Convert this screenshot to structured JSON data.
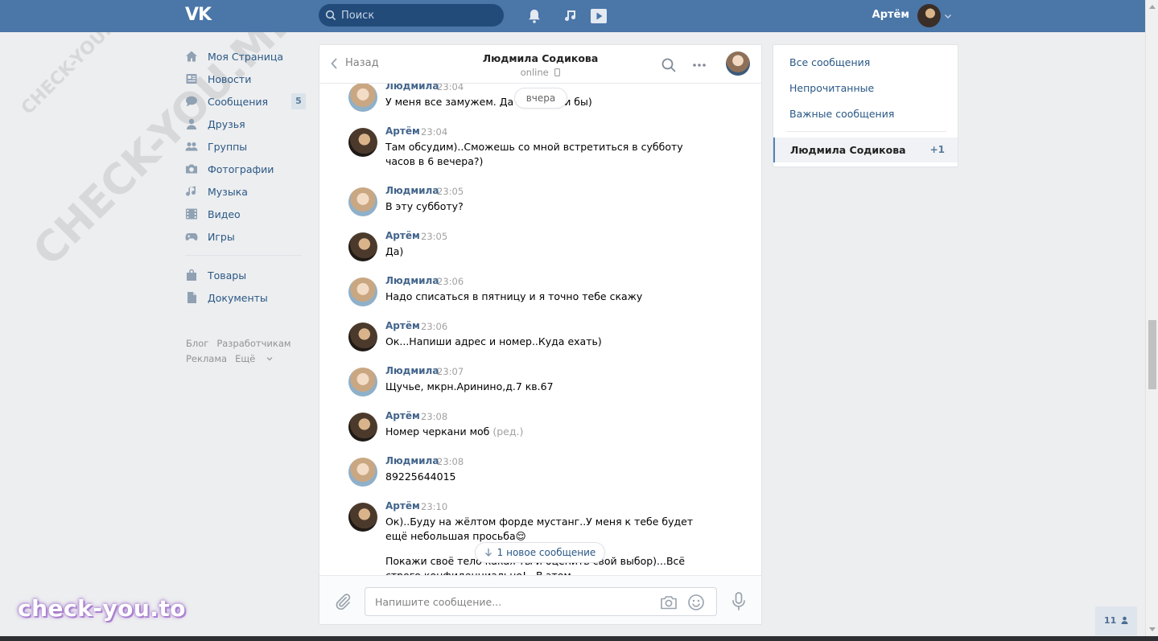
{
  "header": {
    "logo": "VK",
    "search_placeholder": "Поиск",
    "user_name": "Артём"
  },
  "nav": {
    "items": [
      {
        "label": "Моя Страница",
        "icon": "home-icon"
      },
      {
        "label": "Новости",
        "icon": "news-icon"
      },
      {
        "label": "Сообщения",
        "icon": "messages-icon",
        "badge": "5"
      },
      {
        "label": "Друзья",
        "icon": "friends-icon"
      },
      {
        "label": "Группы",
        "icon": "groups-icon"
      },
      {
        "label": "Фотографии",
        "icon": "camera-icon"
      },
      {
        "label": "Музыка",
        "icon": "music-icon"
      },
      {
        "label": "Видео",
        "icon": "video-icon"
      },
      {
        "label": "Игры",
        "icon": "games-icon"
      }
    ],
    "items2": [
      {
        "label": "Товары",
        "icon": "bag-icon"
      },
      {
        "label": "Документы",
        "icon": "document-icon"
      }
    ],
    "footer": {
      "blog": "Блог",
      "dev": "Разработчикам",
      "ads": "Реклама",
      "more": "Ещё"
    }
  },
  "chat": {
    "back_label": "Назад",
    "title": "Людмила Содикова",
    "status": "online",
    "date_pill": "вчера",
    "new_messages_pill": "1 новое сообщение",
    "composer_placeholder": "Напишите сообщение...",
    "messages": [
      {
        "author": "Людмила",
        "time": "23:04",
        "text": "У меня все замужем. Да н             е пошли бы)"
      },
      {
        "author": "Артём",
        "time": "23:04",
        "text": "Там обсудим)..Сможешь со мной встретиться в субботу часов в 6 вечера?)"
      },
      {
        "author": "Людмила",
        "time": "23:05",
        "text": "В эту субботу?"
      },
      {
        "author": "Артём",
        "time": "23:05",
        "text": "Да)"
      },
      {
        "author": "Людмила",
        "time": "23:06",
        "text": "Надо списаться в пятницу и я точно тебе скажу"
      },
      {
        "author": "Артём",
        "time": "23:06",
        "text": "Ок...Напиши адрес и номер..Куда ехать)"
      },
      {
        "author": "Людмила",
        "time": "23:07",
        "text": "Щучье, мкрн.Аринино,д.7 кв.67"
      },
      {
        "author": "Артём",
        "time": "23:08",
        "text": "Номер черкани моб",
        "edited": "(ред.)"
      },
      {
        "author": "Людмила",
        "time": "23:08",
        "text": "89225644015"
      },
      {
        "author": "Артём",
        "time": "23:10",
        "text": "Ок)..Буду на жёлтом форде мустанг..У меня к тебе будет ещё небольшая просьба😌",
        "text2": "Покажи своё тело                                   какая ты и оценить свой выбор)...Всё строго конфиденциально!...В этом"
      }
    ]
  },
  "right_panel": {
    "all": "Все сообщения",
    "unread": "Непрочитанные",
    "important": "Важные сообщения",
    "active_name": "Людмила Содикова",
    "active_count": "+1"
  },
  "online_count": "11",
  "watermark": {
    "brand": "check-you.to",
    "diagonal_big": "CHECK-YOU.ME",
    "diagonal_small": "CHECK-YOU.ME"
  },
  "colors": {
    "header": "#4a76a8",
    "link": "#2a5885",
    "author": "#42648b"
  }
}
